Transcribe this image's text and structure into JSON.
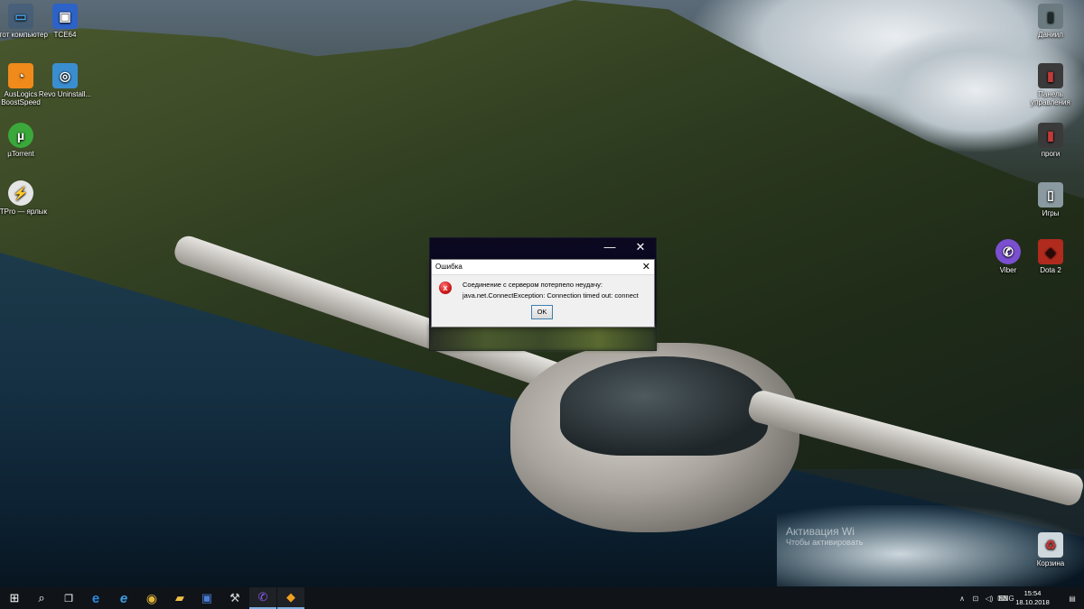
{
  "desktop": {
    "left_icons": [
      {
        "label": "Этот компьютер",
        "icon": "computer-icon",
        "glyph": "▭",
        "color": "#4aa3e8"
      },
      {
        "label": "TCE64",
        "icon": "floppy-disk-icon",
        "glyph": "▣",
        "color": "#2d62c7"
      },
      {
        "label": "AusLogics BoostSpeed",
        "icon": "speedometer-icon",
        "glyph": "◔",
        "color": "#f08a1a"
      },
      {
        "label": "Revo Uninstall...",
        "icon": "revo-uninstaller-icon",
        "glyph": "◎",
        "color": "#3a8ed0"
      },
      {
        "label": "µTorrent",
        "icon": "utorrent-icon",
        "glyph": "µ",
        "color": "#3aa83a"
      },
      {
        "label": "DTPro — ярлык",
        "icon": "daemon-tools-icon",
        "glyph": "⚡",
        "color": "#e5e5e5"
      }
    ],
    "right_icons": [
      {
        "label": "Даниил",
        "icon": "user-folder-icon",
        "glyph": "▮",
        "color": "#6b7a7e"
      },
      {
        "label": "Панель управления",
        "icon": "control-panel-icon",
        "glyph": "▮",
        "color": "#3a3a3a"
      },
      {
        "label": "проги",
        "icon": "folder-programs-icon",
        "glyph": "▮",
        "color": "#3a3a3a"
      },
      {
        "label": "Игры",
        "icon": "games-folder-icon",
        "glyph": "▯",
        "color": "#8a9aa0"
      },
      {
        "label": "Viber",
        "icon": "viber-icon",
        "glyph": "✆",
        "color": "#7b4fd1"
      },
      {
        "label": "Dota 2",
        "icon": "dota2-icon",
        "glyph": "◆",
        "color": "#b02a1e"
      },
      {
        "label": "Корзина",
        "icon": "recycle-bin-icon",
        "glyph": "♻",
        "color": "#9aa8b0"
      }
    ]
  },
  "watermark": {
    "line1": "Активация Wi",
    "line2": "Чтобы активировать"
  },
  "parent_window": {
    "minimize": "—",
    "close": "✕"
  },
  "dialog": {
    "title": "Ошибка",
    "close": "✕",
    "error_glyph": "x",
    "line1": "Соединение с сервером потерпело неудачу:",
    "line2": "java.net.ConnectException: Connection timed out: connect",
    "ok_label": "OK"
  },
  "taskbar": {
    "buttons": [
      {
        "name": "start-button",
        "icon": "windows-logo-icon",
        "glyph": "⊞",
        "color": "#ffffff",
        "active": false
      },
      {
        "name": "search-button",
        "icon": "search-icon",
        "glyph": "⌕",
        "color": "#ffffff",
        "active": false
      },
      {
        "name": "task-view-button",
        "icon": "task-view-icon",
        "glyph": "❐",
        "color": "#ffffff",
        "active": false
      },
      {
        "name": "edge-button",
        "icon": "edge-icon",
        "glyph": "e",
        "color": "#2b8be0",
        "active": false
      },
      {
        "name": "ie-button",
        "icon": "internet-explorer-icon",
        "glyph": "e",
        "color": "#3ca0e6",
        "active": false
      },
      {
        "name": "chrome-button",
        "icon": "chrome-icon",
        "glyph": "◉",
        "color": "#e3b63a",
        "active": false
      },
      {
        "name": "explorer-button",
        "icon": "file-explorer-icon",
        "glyph": "▰",
        "color": "#f1c04a",
        "active": false
      },
      {
        "name": "floppy-app-button",
        "icon": "floppy-disk-icon",
        "glyph": "▣",
        "color": "#4b7fd6",
        "active": false
      },
      {
        "name": "tools-app-button",
        "icon": "tools-icon",
        "glyph": "⚒",
        "color": "#d0d0d0",
        "active": false
      },
      {
        "name": "viber-button",
        "icon": "viber-icon",
        "glyph": "✆",
        "color": "#8a5cf0",
        "active": true
      },
      {
        "name": "java-app-button",
        "icon": "java-app-icon",
        "glyph": "◆",
        "color": "#f0a020",
        "active": true
      }
    ],
    "tray": {
      "chevron": "∧",
      "network": "⊡",
      "volume": "◁)",
      "keyboard": "⌨",
      "language": "ENG",
      "time": "15:54",
      "date": "18.10.2018",
      "notification": "▤"
    }
  }
}
